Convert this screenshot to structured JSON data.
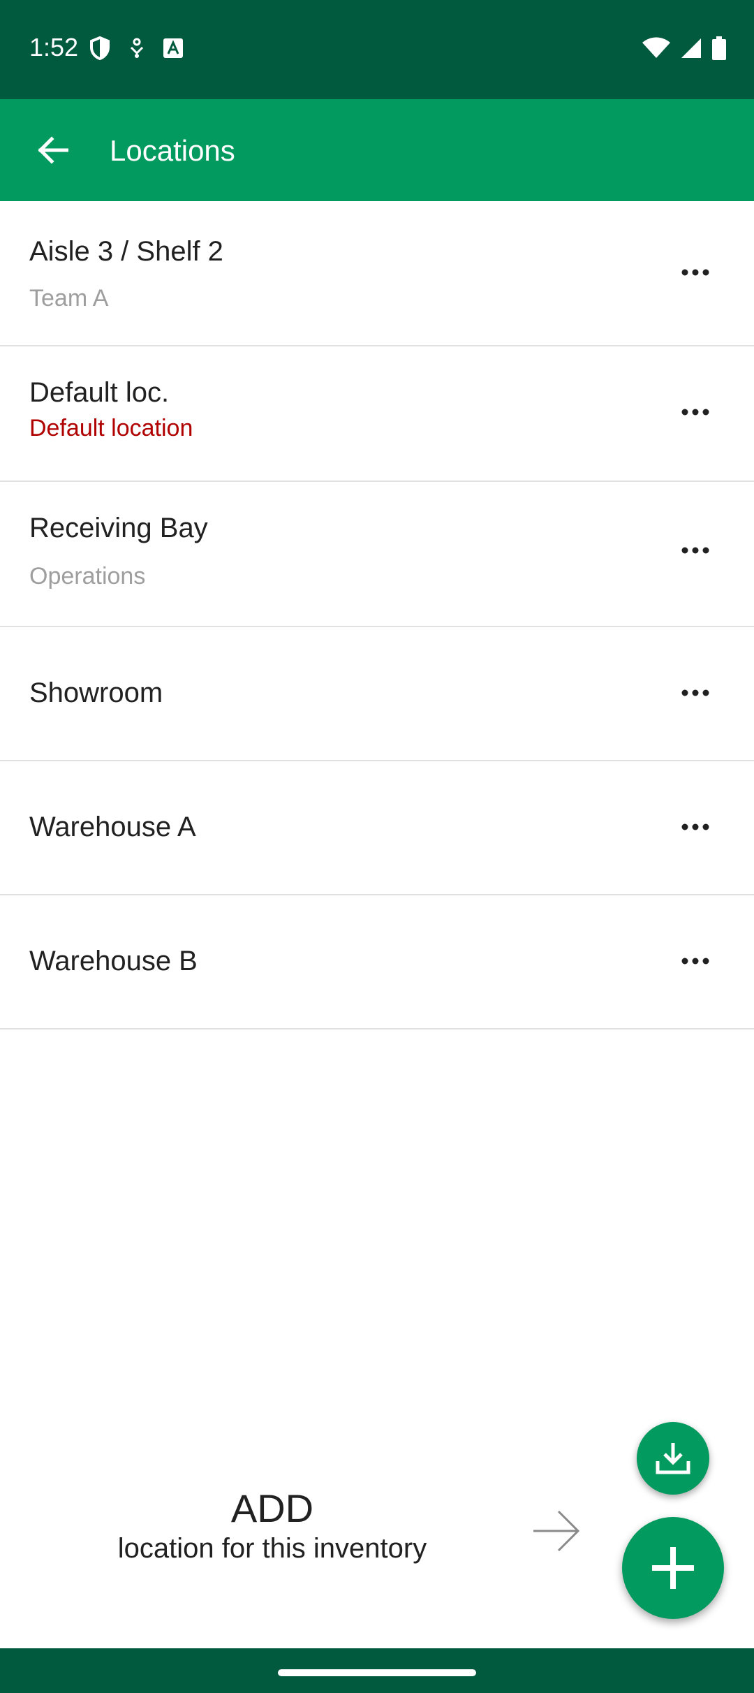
{
  "status_bar": {
    "time": "1:52",
    "left_icons": [
      "shield-icon",
      "usb-icon",
      "font-a-icon"
    ],
    "right_icons": [
      "wifi-icon",
      "signal-icon",
      "battery-icon"
    ],
    "background": "#025a3e"
  },
  "app_bar": {
    "title": "Locations",
    "background": "#029a5e"
  },
  "locations": [
    {
      "name": "Aisle 3 / Shelf 2",
      "subtitle": "Team A",
      "subtitle_style": "gray"
    },
    {
      "name": "Default loc.",
      "subtitle": "Default location",
      "subtitle_style": "red"
    },
    {
      "name": "Receiving Bay",
      "subtitle": "Operations",
      "subtitle_style": "gray"
    },
    {
      "name": "Showroom",
      "subtitle": ""
    },
    {
      "name": "Warehouse A",
      "subtitle": ""
    },
    {
      "name": "Warehouse B",
      "subtitle": ""
    }
  ],
  "hint": {
    "title": "ADD",
    "subtitle": "location for this inventory"
  },
  "fabs": {
    "small_icon": "download-icon",
    "large_icon": "plus-icon",
    "color": "#029a5e"
  },
  "colors": {
    "accent": "#029a5e",
    "dark": "#025a3e",
    "subtitle_gray": "#9e9e9e",
    "subtitle_red": "#b00000"
  }
}
